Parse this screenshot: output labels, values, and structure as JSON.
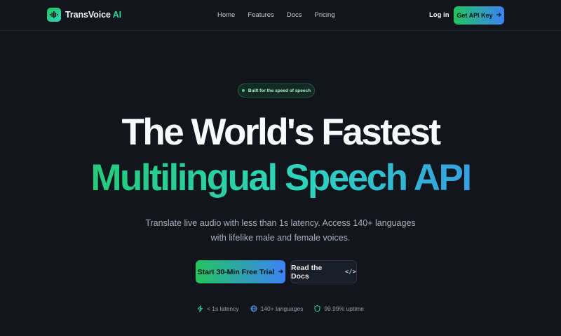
{
  "brand": {
    "name": "TransVoice",
    "accent": "AI",
    "logo": "waveform-logo-icon"
  },
  "nav": {
    "links": [
      "Home",
      "Features",
      "Docs",
      "Pricing"
    ]
  },
  "header": {
    "login": "Log in",
    "cta": "Get API Key",
    "cta_icon": "arrow-right-icon"
  },
  "hero": {
    "badge": "Built for the speed of speech",
    "headline_line1": "The World's Fastest",
    "headline_line2": "Multilingual Speech API",
    "subtitle_line1": "Translate live audio with less than 1s latency. Access 140+ languages",
    "subtitle_line2": "with lifelike male and female voices.",
    "primary_cta": "Start 30-Min Free Trial",
    "primary_cta_icon": "arrow-right-icon",
    "secondary_cta": "Read the Docs",
    "secondary_cta_icon": "code-icon"
  },
  "stats": [
    {
      "label": "< 1s latency",
      "icon": "lightning-icon"
    },
    {
      "label": "140+ languages",
      "icon": "globe-icon"
    },
    {
      "label": "99.99% uptime",
      "icon": "shield-icon"
    }
  ],
  "colors": {
    "background": "#12151c",
    "green": "#22c55e",
    "teal": "#2dd4bf",
    "blue": "#3b82f6"
  }
}
